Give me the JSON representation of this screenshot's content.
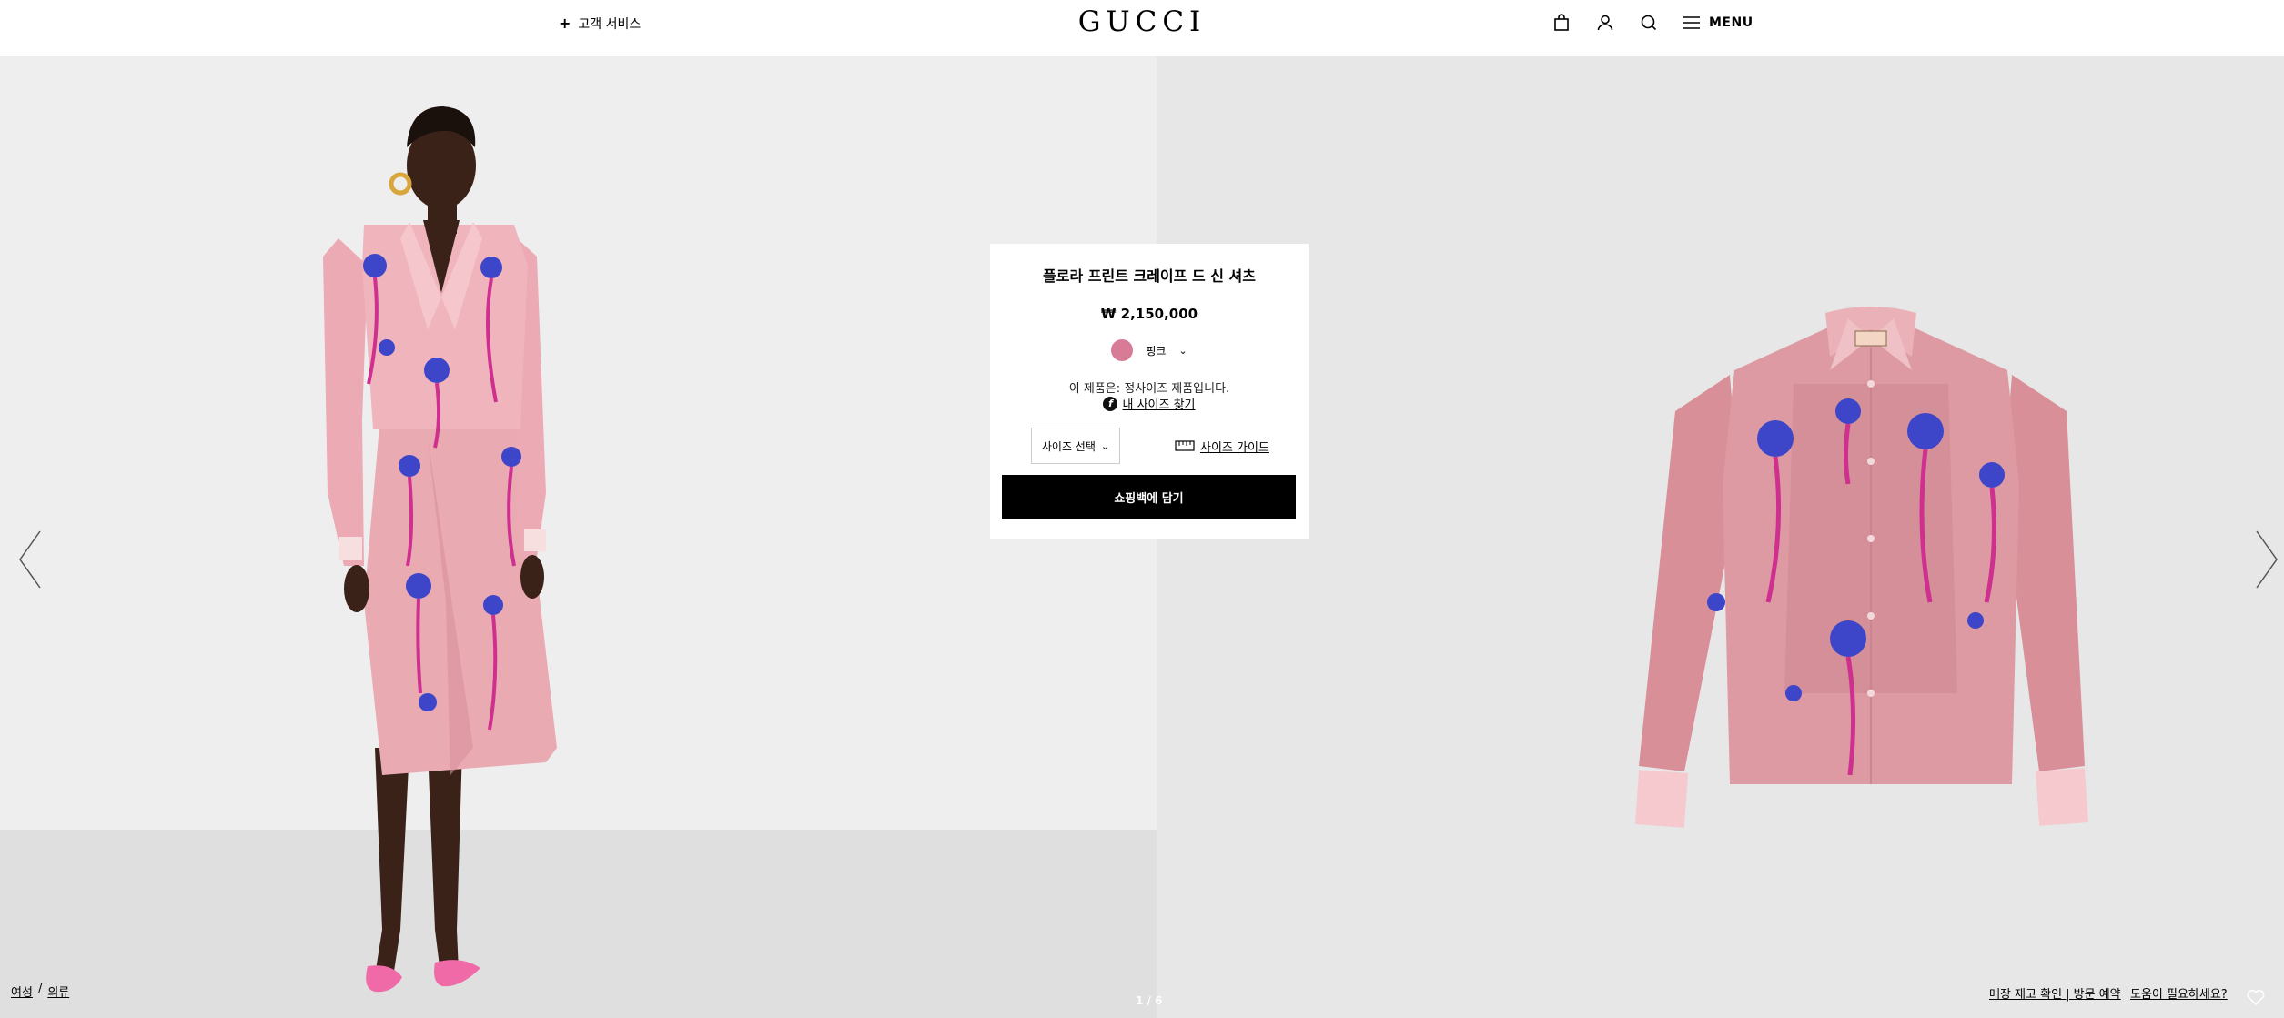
{
  "header": {
    "customer_service_label": "고객 서비스",
    "logo_text": "GUCCI",
    "menu_label": "MENU",
    "icons": [
      "shopping-bag-icon",
      "account-icon",
      "search-icon",
      "hamburger-icon"
    ]
  },
  "product": {
    "name": "플로라 프린트 크레이프 드 신 셔츠",
    "price": "₩ 2,150,000",
    "color": {
      "name": "핑크",
      "swatch": "#d77b96"
    },
    "fit_note": "이 제품은: 정사이즈 제품입니다.",
    "find_size_badge": "f",
    "find_size_label": "내 사이즈 찾기",
    "size_select_label": "사이즈 선택",
    "size_guide_label": "사이즈 가이드",
    "add_to_bag_label": "쇼핑백에 담기"
  },
  "gallery": {
    "pager": "1 / 6",
    "left_image": "model wearing pink floral print shirt and matching skirt",
    "right_image": "pink floral print crepe de chine shirt flat shot"
  },
  "breadcrumb": {
    "items": [
      "여성",
      "의류"
    ],
    "separator": "/"
  },
  "footer": {
    "store_link": "매장 재고 확인 | 방문 예약",
    "help_link": "도움이 필요하세요?"
  },
  "colors": {
    "left_bg": "#eeeeef",
    "right_bg": "#e7e7e7",
    "button_bg": "#000000",
    "fabric_pink": "#e8a2ad",
    "rose_blue": "#3d46c8",
    "stem_magenta": "#cf2f8f"
  }
}
